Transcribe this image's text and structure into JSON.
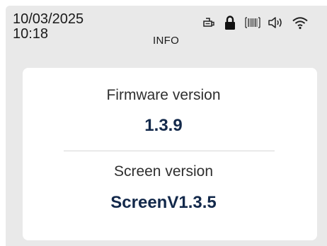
{
  "status_bar": {
    "date": "10/03/2025",
    "time": "10:18",
    "title": "INFO",
    "icons": [
      "printer-icon",
      "lock-icon",
      "barcode-icon",
      "speaker-icon",
      "wifi-icon"
    ]
  },
  "info": {
    "firmware_label": "Firmware version",
    "firmware_value": "1.3.9",
    "screen_label": "Screen version",
    "screen_value": "ScreenV1.3.5"
  },
  "colors": {
    "background": "#e9e9e9",
    "card": "#ffffff",
    "value_text": "#13294b",
    "label_text": "#2f2f2f"
  }
}
